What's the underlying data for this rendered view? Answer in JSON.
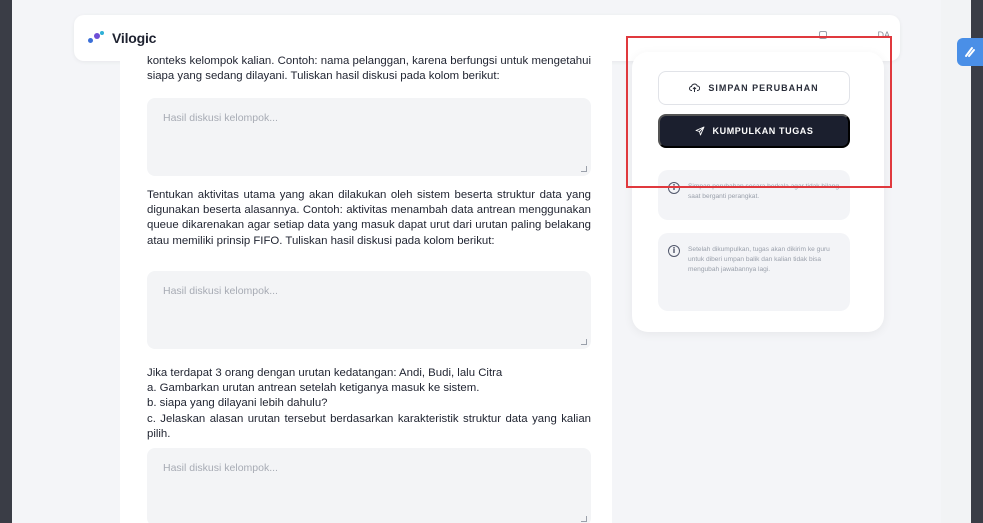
{
  "navbar": {
    "brand": "Vilogic",
    "right_text": "DA"
  },
  "questions": [
    {
      "text": "konteks kelompok kalian. Contoh: nama pelanggan, karena berfungsi untuk mengetahui siapa yang sedang dilayani. Tuliskan hasil diskusi pada kolom berikut:",
      "placeholder": "Hasil diskusi kelompok..."
    },
    {
      "text": "Tentukan aktivitas utama yang akan dilakukan oleh sistem beserta struktur data yang digunakan beserta alasannya. Contoh: aktivitas menambah data antrean menggunakan queue dikarenakan agar setiap data yang masuk dapat urut dari urutan paling belakang atau memiliki prinsip FIFO. Tuliskan hasil diskusi pada kolom berikut:",
      "placeholder": "Hasil diskusi kelompok..."
    },
    {
      "lines": [
        "Jika terdapat 3 orang dengan urutan kedatangan: Andi, Budi, lalu Citra",
        "a. Gambarkan urutan antrean setelah ketiganya masuk ke sistem.",
        "b. siapa yang dilayani lebih dahulu?",
        "c. Jelaskan alasan urutan tersebut berdasarkan karakteristik struktur data yang kalian pilih."
      ],
      "placeholder": "Hasil diskusi kelompok..."
    }
  ],
  "sidebar": {
    "save_label": "SIMPAN PERUBAHAN",
    "submit_label": "KUMPULKAN TUGAS",
    "info1": "Simpan perubahan secara berkala agar tidak hilang saat berganti perangkat.",
    "info2": "Setelah dikumpulkan, tugas akan dikirim ke guru untuk diberi umpan balik dan kalian tidak bisa mengubah jawabannya lagi."
  },
  "colors": {
    "highlight": "#e0393e",
    "primary_dark": "#1b1f2e",
    "accent": "#4a8fe7"
  }
}
